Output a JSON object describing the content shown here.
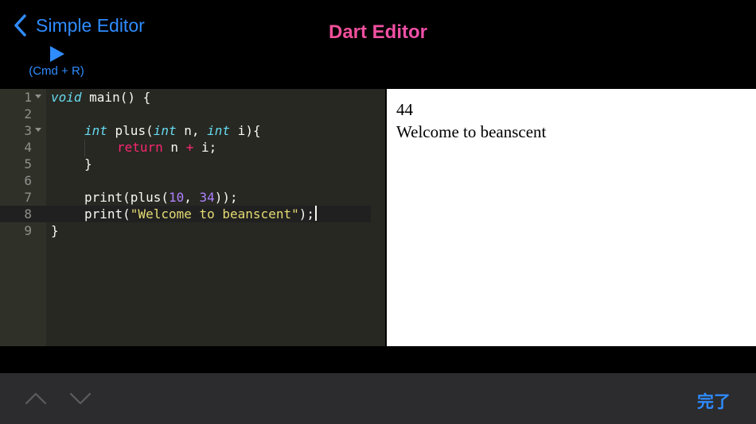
{
  "header": {
    "back_label": "Simple Editor",
    "title": "Dart Editor",
    "run_hint": "(Cmd + R)"
  },
  "editor": {
    "line_numbers": [
      "1",
      "2",
      "3",
      "4",
      "5",
      "6",
      "7",
      "8",
      "9"
    ],
    "active_line": 8,
    "code": {
      "l1_void": "void",
      "l1_rest": " main() {",
      "l3_int1": "int",
      "l3_mid1": " plus(",
      "l3_int2": "int",
      "l3_mid2": " n, ",
      "l3_int3": "int",
      "l3_end": " i){",
      "l4_return": "return",
      "l4_n": " n ",
      "l4_plus": "+",
      "l4_end": " i;",
      "l5": "}",
      "l7_start": "print(plus(",
      "l7_n1": "10",
      "l7_comma": ", ",
      "l7_n2": "34",
      "l7_end": "));",
      "l8_start": "print(",
      "l8_str": "\"Welcome to beanscent\"",
      "l8_end": ");",
      "l9": "}"
    }
  },
  "output": {
    "lines": [
      "44",
      "Welcome to beanscent"
    ]
  },
  "toolbar": {
    "done_label": "完了"
  },
  "colors": {
    "accent": "#2f8cff",
    "editor_bg": "#272822",
    "keyword": "#f92672",
    "type": "#66d9ef",
    "number": "#ae81ff",
    "string": "#e6db74"
  }
}
